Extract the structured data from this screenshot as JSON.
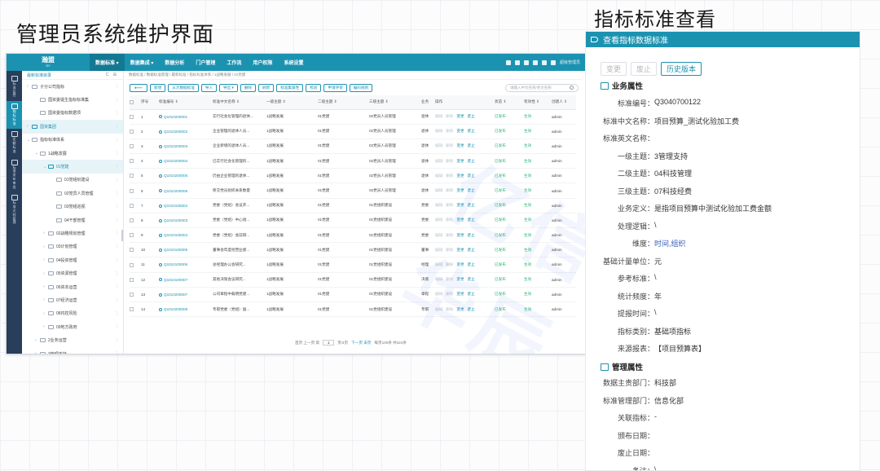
{
  "slide": {
    "left_title": "管理员系统维护界面",
    "right_title": "指标标准查看"
  },
  "app": {
    "logo_line1": "瀚盟",
    "logo_line2": "SY",
    "top_nav": [
      "数据标准 ▾",
      "数据集成 ▾",
      "数据分析",
      "门户管理",
      "工作流",
      "用户权限",
      "系统设置"
    ],
    "user": "超级管理员",
    "rail": [
      {
        "label": "标准监控"
      },
      {
        "label": "指标标准"
      },
      {
        "label": "定额标准"
      },
      {
        "label": "标准发布审批"
      },
      {
        "label": "标准文档管理"
      }
    ],
    "tree": {
      "header": "最新标准目录",
      "tools": "C ⊞",
      "items": [
        {
          "label": "子分公司指标",
          "indent": 0,
          "caret": "›"
        },
        {
          "label": "国资委诞生指标标准集",
          "indent": 1,
          "caret": ""
        },
        {
          "label": "国资委指标数据项",
          "indent": 1,
          "caret": ""
        },
        {
          "label": "国资集团",
          "indent": 0,
          "caret": "›",
          "selected": true
        },
        {
          "label": "指标标准体系",
          "indent": 0,
          "caret": "⌄"
        },
        {
          "label": "1战略发展",
          "indent": 1,
          "caret": "⌄"
        },
        {
          "label": "01党建",
          "indent": 2,
          "caret": "⌄",
          "selected": true
        },
        {
          "label": "01党组织建设",
          "indent": 3,
          "caret": ""
        },
        {
          "label": "02党员人员管理",
          "indent": 3,
          "caret": ""
        },
        {
          "label": "03党组巡视",
          "indent": 3,
          "caret": ""
        },
        {
          "label": "04干部管理",
          "indent": 3,
          "caret": ""
        },
        {
          "label": "02战略规划管理",
          "indent": 2,
          "caret": "›"
        },
        {
          "label": "03计划管理",
          "indent": 2,
          "caret": "›"
        },
        {
          "label": "04投资管理",
          "indent": 2,
          "caret": "›"
        },
        {
          "label": "05资源管理",
          "indent": 2,
          "caret": "›"
        },
        {
          "label": "06资本运营",
          "indent": 2,
          "caret": "›"
        },
        {
          "label": "07经济运营",
          "indent": 2,
          "caret": "›"
        },
        {
          "label": "08内控风险",
          "indent": 2,
          "caret": "›"
        },
        {
          "label": "09地方政府",
          "indent": 2,
          "caret": "›"
        },
        {
          "label": "2业务运营",
          "indent": 1,
          "caret": "›"
        },
        {
          "label": "3管理支持",
          "indent": 1,
          "caret": "›"
        }
      ]
    },
    "breadcrumb": "数据标准 / 数据标准管理 / 最新标准 / 指标标准体系 / 1战略发展 / 01党建",
    "toolbar": [
      "新增",
      "从大数据标准",
      "导入",
      "导出 ▾",
      "删除",
      "刷新",
      "标准集属性",
      "校验",
      "申请评审",
      "编码规则"
    ],
    "back_label": "⟵",
    "search_placeholder": "请输入中文名称/英文名称",
    "columns": [
      "",
      "序号",
      "标准编号 ⇕",
      "标准中文名称 ⇕",
      "一级主题 ⇕",
      "二级主题 ⇕",
      "三级主题 ⇕",
      "业务",
      "操作",
      "状态 ⇕",
      "有效性 ⇕",
      "创建人 ⇕"
    ],
    "rows": [
      {
        "n": "1",
        "code": "Q1010200001",
        "name": "实行社会化管理的退休...",
        "l1": "1战略发展",
        "l2": "01党建",
        "l3": "02党员人员管理",
        "biz": "退休",
        "status": "已发布",
        "valid": "生效",
        "creator": "admin"
      },
      {
        "n": "2",
        "code": "Q1010200002",
        "name": "企业管理的退休人员...",
        "l1": "1战略发展",
        "l2": "01党建",
        "l3": "02党员人员管理",
        "biz": "退休",
        "status": "已发布",
        "valid": "生效",
        "creator": "admin"
      },
      {
        "n": "3",
        "code": "Q1010200003",
        "name": "企业新增的退休人员...",
        "l1": "1战略发展",
        "l2": "01党建",
        "l3": "02党员人员管理",
        "biz": "退休",
        "status": "已发布",
        "valid": "生效",
        "creator": "admin"
      },
      {
        "n": "4",
        "code": "Q1010200004",
        "name": "已实行社会化管理的...",
        "l1": "1战略发展",
        "l2": "01党建",
        "l3": "02党员人员管理",
        "biz": "退休",
        "status": "已发布",
        "valid": "生效",
        "creator": "admin"
      },
      {
        "n": "5",
        "code": "Q1010200005",
        "name": "仍由企业管理的退休...",
        "l1": "1战略发展",
        "l2": "01党建",
        "l3": "02党员人员管理",
        "biz": "退休",
        "status": "已发布",
        "valid": "生效",
        "creator": "admin"
      },
      {
        "n": "6",
        "code": "Q1010200006",
        "name": "移交党员组织关系数量",
        "l1": "1战略发展",
        "l2": "01党建",
        "l3": "02党员人员管理",
        "biz": "退休",
        "status": "已发布",
        "valid": "生效",
        "creator": "admin"
      },
      {
        "n": "7",
        "code": "Q1010100002",
        "name": "党委（党组）会议开...",
        "l1": "1战略发展",
        "l2": "01党建",
        "l3": "01党组织建设",
        "biz": "党委",
        "status": "已发布",
        "valid": "生效",
        "creator": "admin"
      },
      {
        "n": "8",
        "code": "Q1010100003",
        "name": "党委（党组）中心组...",
        "l1": "1战略发展",
        "l2": "01党建",
        "l3": "01党组织建设",
        "biz": "党委",
        "status": "已发布",
        "valid": "生效",
        "creator": "admin"
      },
      {
        "n": "9",
        "code": "Q1010100004",
        "name": "党委（党组）会前研...",
        "l1": "1战略发展",
        "l2": "01党建",
        "l3": "01党组织建设",
        "biz": "党委",
        "status": "已发布",
        "valid": "生效",
        "creator": "admin"
      },
      {
        "n": "10",
        "code": "Q1010100005",
        "name": "董事会年度经营业绩...",
        "l1": "1战略发展",
        "l2": "01党建",
        "l3": "01党组织建设",
        "biz": "董事",
        "status": "已发布",
        "valid": "生效",
        "creator": "admin"
      },
      {
        "n": "11",
        "code": "Q1010100006",
        "name": "总经理办公会研究...",
        "l1": "1战略发展",
        "l2": "01党建",
        "l3": "01党组织建设",
        "biz": "经理",
        "status": "已发布",
        "valid": "生效",
        "creator": "admin"
      },
      {
        "n": "12",
        "code": "Q1010100007",
        "name": "其他决策会议研究...",
        "l1": "1战略发展",
        "l2": "01党建",
        "l3": "01党组织建设",
        "biz": "决策",
        "status": "已发布",
        "valid": "生效",
        "creator": "admin"
      },
      {
        "n": "13",
        "code": "Q1010200007",
        "name": "公司章程中载明党建...",
        "l1": "1战略发展",
        "l2": "01党建",
        "l3": "01党组织建设",
        "biz": "章程",
        "status": "已发布",
        "valid": "生效",
        "creator": "admin"
      },
      {
        "n": "14",
        "code": "Q1010200008",
        "name": "专职党委（党组）副...",
        "l1": "1战略发展",
        "l2": "01党建",
        "l3": "01党组织建设",
        "biz": "专职",
        "status": "已发布",
        "valid": "生效",
        "creator": "admin"
      }
    ],
    "row_ops": [
      "编辑",
      "删除",
      "变更",
      "废止"
    ],
    "pager": {
      "summary": "首页 上一页 第",
      "page": "1",
      "total_pages": "页/4页",
      "next": "下一页 末页",
      "summary2": "每页100条 共324条"
    },
    "watermark": "亿信华辰"
  },
  "panel": {
    "header": "查看指标数据标准",
    "buttons": [
      "变更",
      "废止",
      "历史版本"
    ],
    "section_business": "业务属性",
    "section_manage": "管理属性",
    "business_fields": [
      {
        "label": "标准编号：",
        "value": "Q3040700122"
      },
      {
        "label": "标准中文名称：",
        "value": "项目预算_测试化验加工费"
      },
      {
        "label": "标准英文名称：",
        "value": ""
      },
      {
        "label": "一级主题：",
        "value": "3管理支持"
      },
      {
        "label": "二级主题：",
        "value": "04科技管理"
      },
      {
        "label": "三级主题：",
        "value": "07科技经费"
      },
      {
        "label": "业务定义：",
        "value": "是指项目预算中测试化验加工费金额"
      },
      {
        "label": "处理逻辑：",
        "value": "\\"
      },
      {
        "label": "维度：",
        "value": "时间,组织",
        "link": true
      },
      {
        "label": "基础计量单位：",
        "value": "元"
      },
      {
        "label": "参考标准：",
        "value": "\\"
      },
      {
        "label": "统计频度：",
        "value": "年"
      },
      {
        "label": "提报时间：",
        "value": "\\"
      },
      {
        "label": "指标类别：",
        "value": "基础项指标"
      },
      {
        "label": "来源报表：",
        "value": "【项目预算表】"
      }
    ],
    "manage_fields": [
      {
        "label": "数据主责部门：",
        "value": "科技部"
      },
      {
        "label": "标准管理部门：",
        "value": "信息化部"
      },
      {
        "label": "关联指标：",
        "value": "-"
      },
      {
        "label": "颁布日期：",
        "value": ""
      },
      {
        "label": "废止日期：",
        "value": ""
      },
      {
        "label": "备注：",
        "value": "\\"
      }
    ]
  }
}
